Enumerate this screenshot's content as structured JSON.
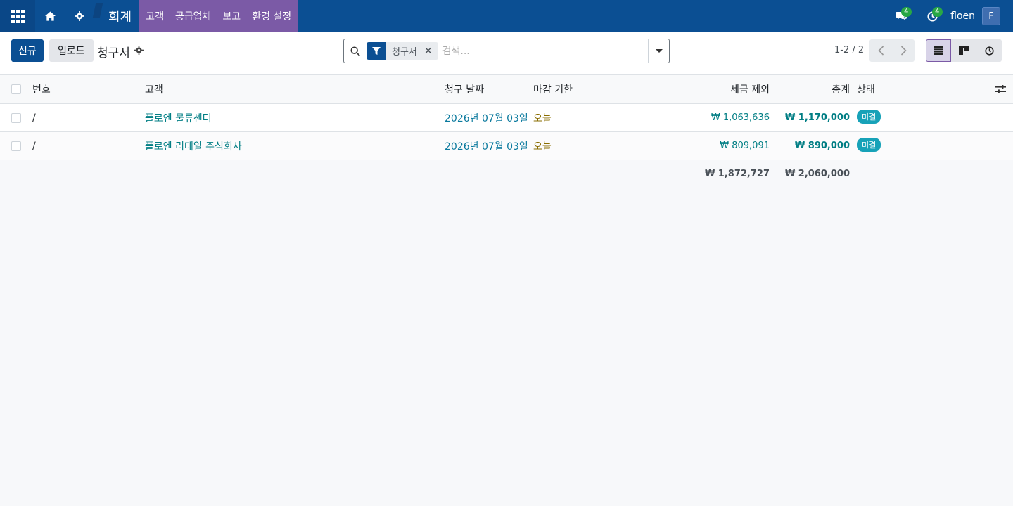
{
  "navbar": {
    "app_name": "회계",
    "menus": [
      "고객",
      "공급업체",
      "보고",
      "환경 설정"
    ],
    "messages_count": "4",
    "activities_count": "4",
    "username": "floen",
    "avatar_letter": "F"
  },
  "control": {
    "new_label": "신규",
    "upload_label": "업로드",
    "title": "청구서",
    "search_facet": "청구서",
    "search_placeholder": "검색...",
    "pager_text": "1-2 / 2"
  },
  "table": {
    "headers": {
      "number": "번호",
      "customer": "고객",
      "invoice_date": "청구 날짜",
      "due_date": "마감 기한",
      "untaxed": "세금 제외",
      "total": "총계",
      "status": "상태"
    },
    "rows": [
      {
        "number": "/",
        "customer": "플로엔 물류센터",
        "invoice_date": "2026년 07월 03일",
        "due_date": "오늘",
        "untaxed": "₩ 1,063,636",
        "total": "₩ 1,170,000",
        "status": "미결"
      },
      {
        "number": "/",
        "customer": "플로엔 리테일 주식회사",
        "invoice_date": "2026년 07월 03일",
        "due_date": "오늘",
        "untaxed": "₩ 809,091",
        "total": "₩ 890,000",
        "status": "미결"
      }
    ],
    "footer": {
      "untaxed_sum": "₩ 1,872,727",
      "total_sum": "₩ 2,060,000"
    }
  },
  "colors": {
    "navbar": "#0b4f93",
    "menu_bar": "#7b5aa6",
    "accent": "#017e84",
    "status_pill": "#17a2b8"
  },
  "icons": [
    "apps-grid-icon",
    "home-icon",
    "gear-icon",
    "chat-icon",
    "clock-icon",
    "search-icon",
    "filter-icon",
    "close-icon",
    "caret-down-icon",
    "chevron-left-icon",
    "chevron-right-icon",
    "list-view-icon",
    "kanban-view-icon",
    "activity-view-icon",
    "settings-sliders-icon"
  ]
}
